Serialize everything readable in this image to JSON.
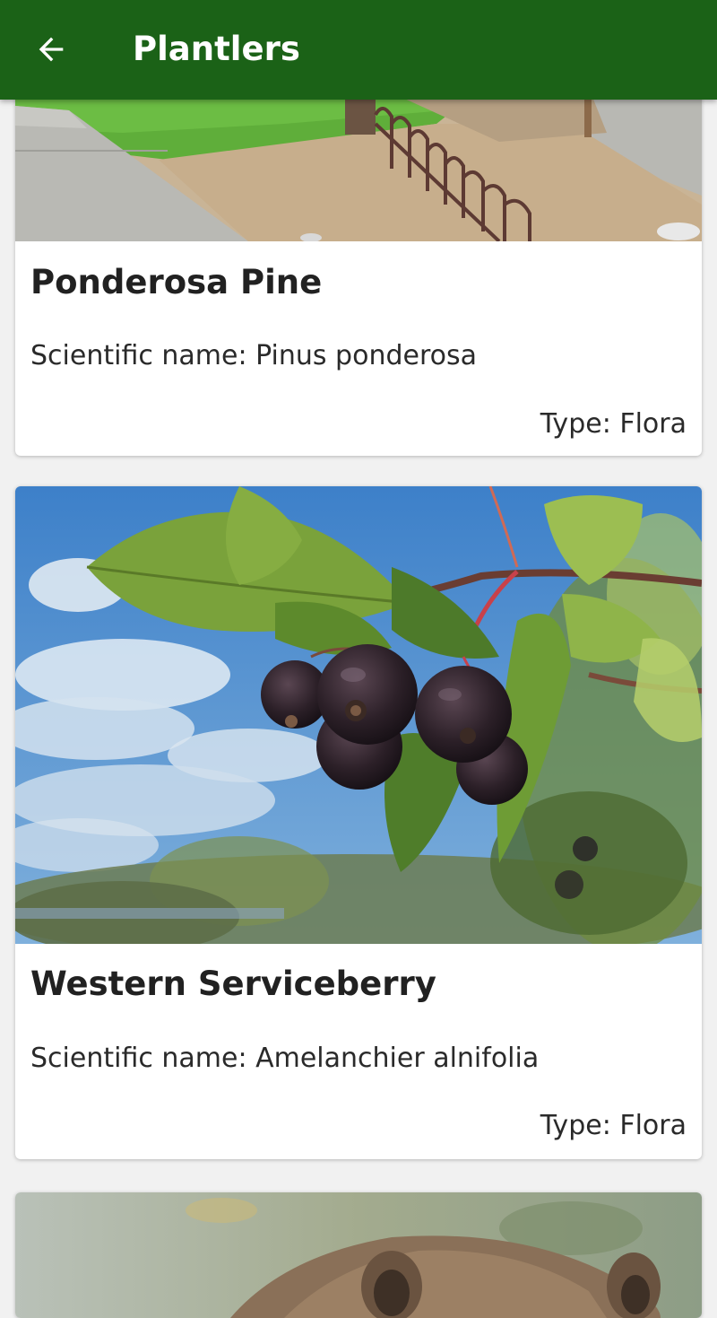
{
  "app_bar": {
    "title": "Plantlers",
    "back_icon": "arrow-back-icon",
    "background_color": "#1b6217"
  },
  "cards": [
    {
      "name": "Ponderosa Pine",
      "scientific_name": "Scientific name: Pinus ponderosa",
      "type": "Type: Flora",
      "image_icon": "park-path-photo"
    },
    {
      "name": "Western Serviceberry",
      "scientific_name": "Scientific name: Amelanchier alnifolia",
      "type": "Type: Flora",
      "image_icon": "serviceberry-photo"
    },
    {
      "image_icon": "animal-photo"
    }
  ]
}
